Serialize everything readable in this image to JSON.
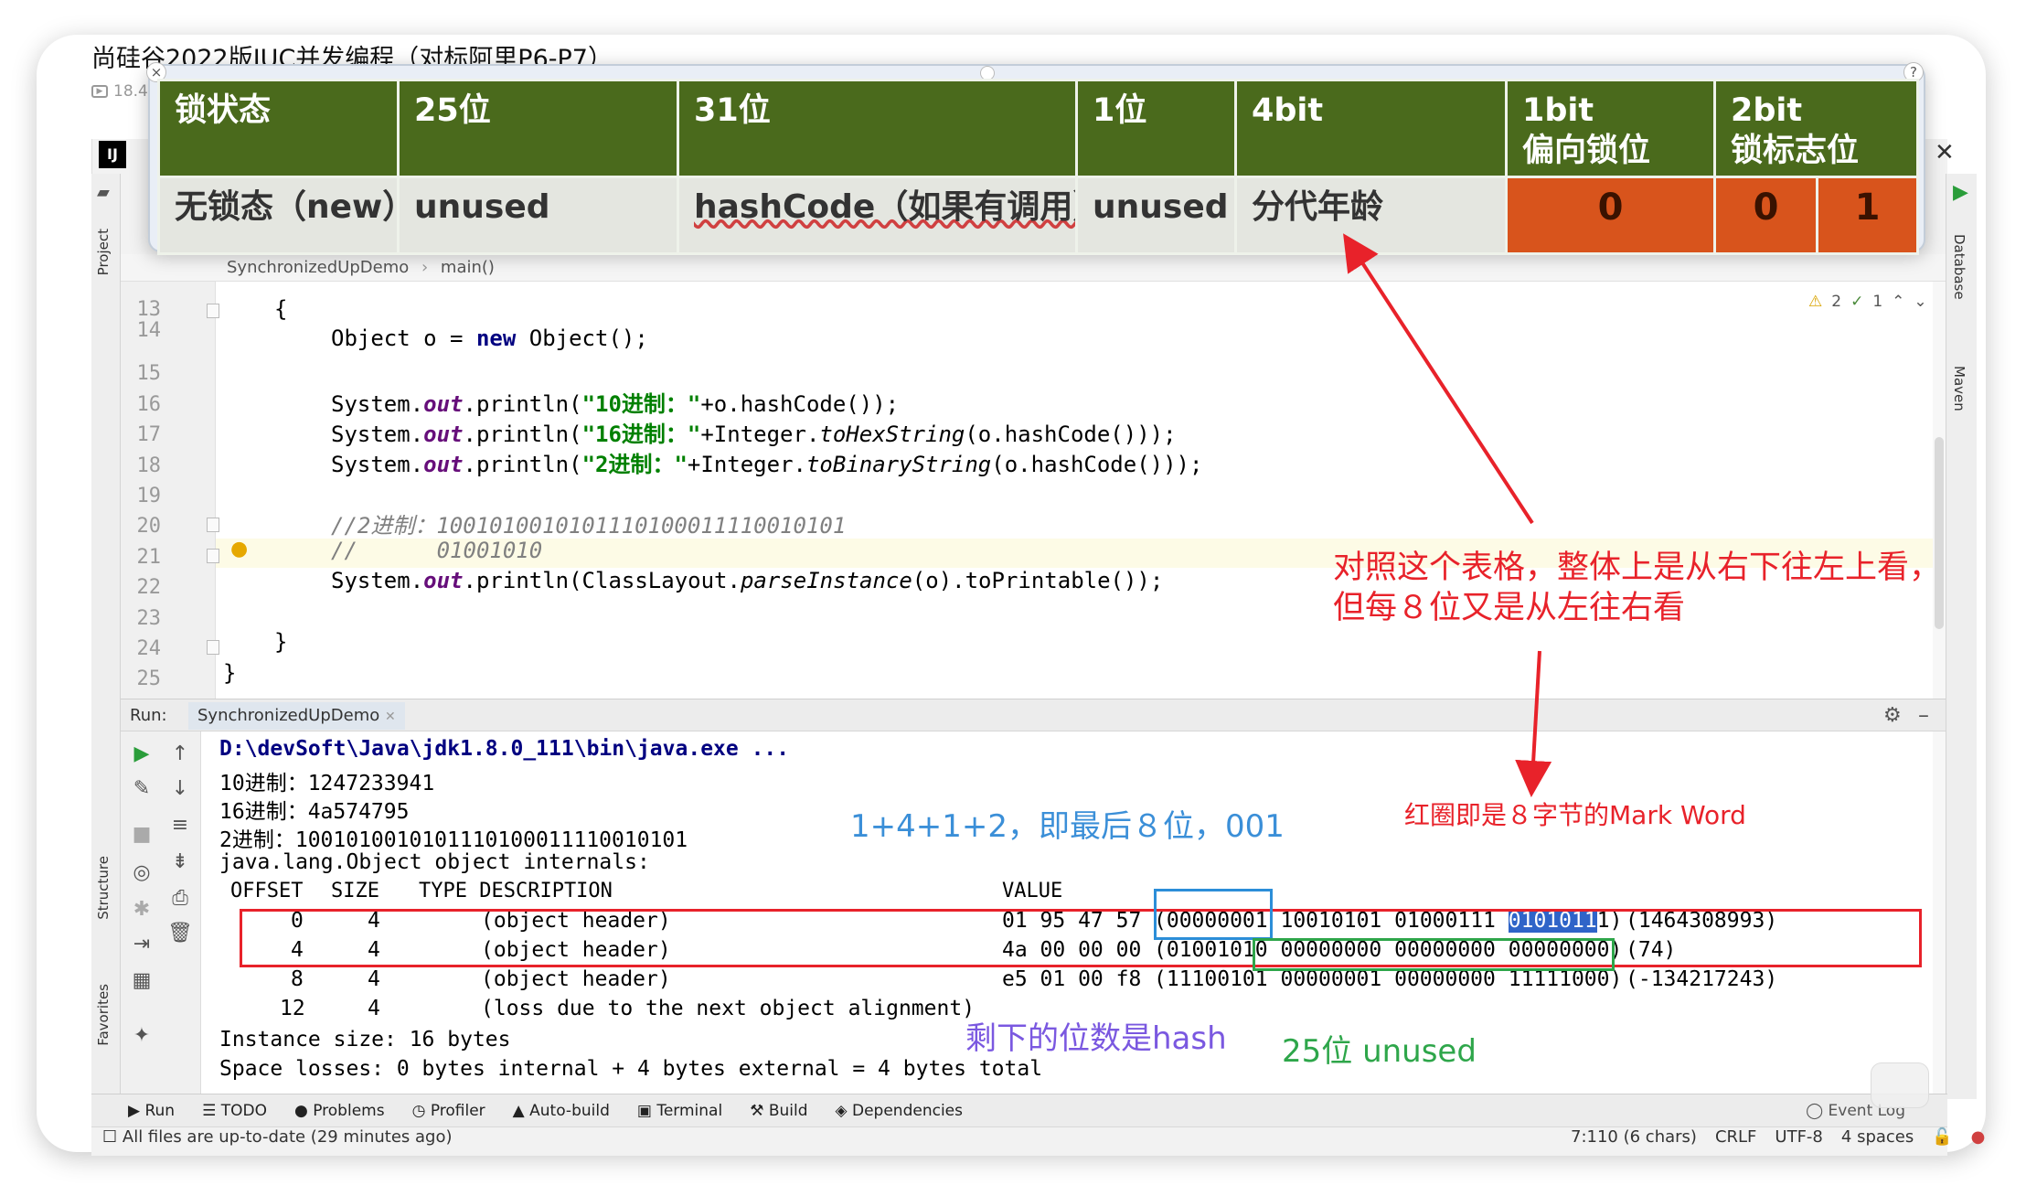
{
  "video": {
    "title": "尚硅谷2022版JUC并发编程（对标阿里P6-P7）",
    "views": "18.4"
  },
  "ide": {
    "logo": "IJ",
    "left_tabs": [
      "Project",
      "Structure",
      "Favorites"
    ],
    "right_tabs": [
      "Database",
      "Maven"
    ],
    "breadcrumb": [
      "SynchronizedUpDemo",
      "main()"
    ],
    "inspection": {
      "warnings": "2",
      "weak_warnings": "1"
    }
  },
  "editor": {
    "lines": [
      {
        "n": "13",
        "code": "{"
      },
      {
        "n": "14",
        "code": "Object o = new Object();"
      },
      {
        "n": "15",
        "code": ""
      },
      {
        "n": "16",
        "p1": "System.",
        "f": "out",
        "p2": ".println(",
        "s": "\"10进制：\"",
        "p3": "+o.hashCode());"
      },
      {
        "n": "17",
        "p1": "System.",
        "f": "out",
        "p2": ".println(",
        "s": "\"16进制：\"",
        "p3": "+Integer.",
        "i": "toHexString",
        "p4": "(o.hashCode()));"
      },
      {
        "n": "18",
        "p1": "System.",
        "f": "out",
        "p2": ".println(",
        "s": "\"2进制：\"",
        "p3": "+Integer.",
        "i": "toBinaryString",
        "p4": "(o.hashCode()));"
      },
      {
        "n": "19",
        "code": ""
      },
      {
        "n": "20",
        "comment": "//2进制：1001010010101110100011110010101"
      },
      {
        "n": "21",
        "comment": "//      01001010"
      },
      {
        "n": "22",
        "p1": "System.",
        "f": "out",
        "p2": ".println(ClassLayout.",
        "i": "parseInstance",
        "p3": "(o).toPrintable());"
      },
      {
        "n": "23",
        "code": ""
      },
      {
        "n": "24",
        "code": "}"
      },
      {
        "n": "25",
        "code": "}"
      }
    ]
  },
  "run": {
    "label": "Run:",
    "tab": "SynchronizedUpDemo",
    "cmd": "D:\\devSoft\\Java\\jdk1.8.0_111\\bin\\java.exe ...",
    "dec": "10进制：1247233941",
    "hex": "16进制：4a574795",
    "bin": "2进制：1001010010101110100011110010101",
    "internals": "java.lang.Object object internals:",
    "header": {
      "offset": "OFFSET",
      "size": "SIZE",
      "type": "TYPE DESCRIPTION",
      "value": "VALUE"
    },
    "rows": [
      {
        "offset": "0",
        "size": "4",
        "desc": "(object header)",
        "hex": "01 95 47 57",
        "b1": "(00000001",
        "b2": "10010101",
        "b3": "01000111",
        "b4a": "0101011",
        "b4b": "1",
        "tail": ")",
        "dec": "(1464308993)"
      },
      {
        "offset": "4",
        "size": "4",
        "desc": "(object header)",
        "hex": "4a 00 00 00",
        "b1": "(0100101",
        "b2": "0 00000000 00000000 00000000)",
        "dec": "(74)"
      },
      {
        "offset": "8",
        "size": "4",
        "desc": "(object header)",
        "hex": "e5 01 00 f8",
        "bits": "(11100101 00000001 00000000 11111000)",
        "dec": "(-134217243)"
      },
      {
        "offset": "12",
        "size": "4",
        "desc": "(loss due to the next object alignment)"
      }
    ],
    "instance": "Instance size: 16 bytes",
    "losses": "Space losses: 0 bytes internal + 4 bytes external = 4 bytes total"
  },
  "tool_tabs": [
    "▶ Run",
    "☰ TODO",
    "● Problems",
    "◷ Profiler",
    "▲ Auto-build",
    "▣ Terminal",
    "⚒ Build",
    "◈ Dependencies"
  ],
  "event_log": "Event Log",
  "status": {
    "left": "All files are up-to-date (29 minutes ago)",
    "pos": "7:110 (6 chars)",
    "crlf": "CRLF",
    "enc": "UTF-8",
    "indent": "4 spaces"
  },
  "lock_table": {
    "headers": [
      "锁状态",
      "25位",
      "31位",
      "1位",
      "4bit",
      "1bit\n偏向锁位",
      "2bit\n锁标志位"
    ],
    "row": {
      "state": "无锁态（new）",
      "b25": "unused",
      "b31": "hashCode（如果有调用）",
      "b1": "unused",
      "age": "分代年龄",
      "biased": "0",
      "flag1": "0",
      "flag2": "1"
    }
  },
  "annotations": {
    "read_order_1": "对照这个表格，整体上是从右下往左上看，",
    "read_order_2": "但每８位又是从左往右看",
    "last8": "1+4+1+2，即最后８位，001",
    "mark_word": "红圈即是８字节的Mark Word",
    "hash_rest": "剩下的位数是hash",
    "unused25": "25位 unused"
  },
  "colors": {
    "header_green": "#4a6a1c",
    "orange_cell": "#d8541c",
    "annotation_red": "#e8222a",
    "annotation_blue": "#3b8fd8",
    "annotation_green": "#2ea64a",
    "annotation_purple": "#7a58e0"
  }
}
